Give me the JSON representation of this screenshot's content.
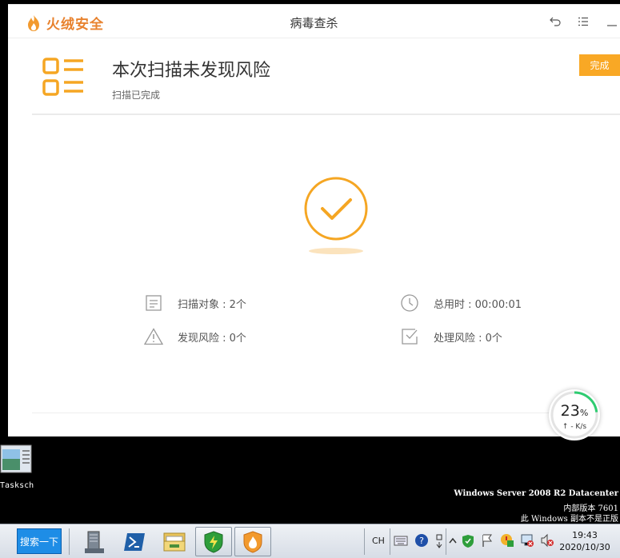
{
  "app": {
    "brand": "火绒安全",
    "window_title": "病毒查杀"
  },
  "result": {
    "title": "本次扫描未发现风险",
    "subtitle": "扫描已完成",
    "done_label": "完成"
  },
  "stats": {
    "scan_objects": "扫描对象 : 2个",
    "total_time": "总用时 : 00:00:01",
    "found_risks": "发现风险 : 0个",
    "handled_risks": "处理风险 : 0个"
  },
  "speed_widget": {
    "percent": "23",
    "percent_unit": "%",
    "rate": "↑ - K/s",
    "fraction": 0.23
  },
  "desktop": {
    "icon_label": "Tasksch",
    "os_line1": "Windows Server 2008 R2 Datacenter",
    "os_line2": "内部版本 7601",
    "os_line3": "此 Windows 副本不是正版"
  },
  "taskbar": {
    "search_label": "搜索一下",
    "lang": "CH",
    "time": "19:43",
    "date": "2020/10/30"
  },
  "colors": {
    "accent": "#f5a623",
    "brand": "#e8822e",
    "done_button": "#f9a825",
    "speed_ring": "#2ecc71"
  }
}
